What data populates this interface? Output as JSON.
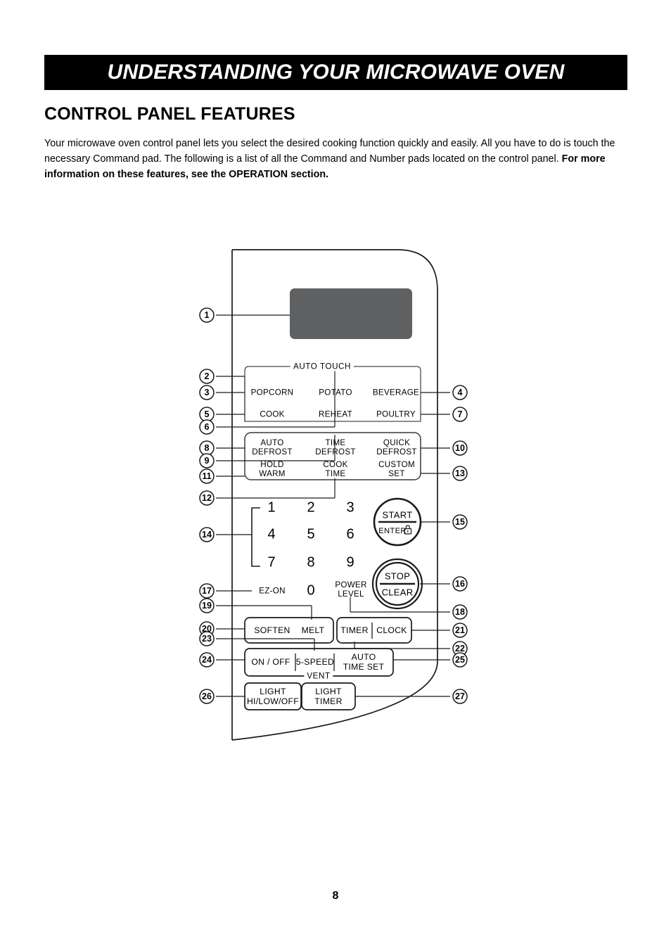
{
  "banner": {
    "title": "UNDERSTANDING YOUR MICROWAVE OVEN"
  },
  "section": {
    "heading": "CONTROL PANEL FEATURES",
    "intro_plain": "Your microwave oven control panel lets you select the desired cooking function quickly and easily. All you have to do is touch the necessary Command pad. The following is a list of all the Command and Number pads located on the control panel. ",
    "intro_bold": "For more information on these features, see the OPERATION section."
  },
  "footer": {
    "page_number": "8"
  },
  "diagram": {
    "display_color": "#5f6062",
    "group_labels": {
      "auto_touch": "AUTO TOUCH",
      "vent": "VENT"
    },
    "auto_touch_pads": [
      {
        "label": "POPCORN",
        "callout": "3"
      },
      {
        "label": "POTATO",
        "callout": "2"
      },
      {
        "label": "BEVERAGE",
        "callout": "4"
      },
      {
        "label": "COOK",
        "callout": "5"
      },
      {
        "label": "REHEAT",
        "callout": "6"
      },
      {
        "label": "POULTRY",
        "callout": "7"
      }
    ],
    "defrost_pads": [
      {
        "line1": "AUTO",
        "line2": "DEFROST",
        "callout": "8"
      },
      {
        "line1": "TIME",
        "line2": "DEFROST",
        "callout": "9"
      },
      {
        "line1": "QUICK",
        "line2": "DEFROST",
        "callout": "10"
      },
      {
        "line1": "HOLD",
        "line2": "WARM",
        "callout": "11"
      },
      {
        "line1": "COOK",
        "line2": "TIME",
        "callout": "12"
      },
      {
        "line1": "CUSTOM",
        "line2": "SET",
        "callout": "13"
      }
    ],
    "number_pads": [
      "1",
      "2",
      "3",
      "4",
      "5",
      "6",
      "7",
      "8",
      "9",
      "0"
    ],
    "number_pad_callout": "14",
    "ez_on": {
      "label": "EZ-ON",
      "callout": "17"
    },
    "power_level": {
      "line1": "POWER",
      "line2": "LEVEL",
      "callout": "18"
    },
    "start_button": {
      "line1": "START",
      "line2": "ENTER",
      "icon": "lock-icon",
      "callout": "15"
    },
    "stop_button": {
      "line1": "STOP",
      "line2": "CLEAR",
      "callout": "16"
    },
    "soften_melt": [
      {
        "label": "SOFTEN",
        "callout": "20"
      },
      {
        "label": "MELT",
        "callout": "19"
      }
    ],
    "timer_clock": [
      {
        "label": "TIMER",
        "callout": "22"
      },
      {
        "label": "CLOCK",
        "callout": "21"
      }
    ],
    "vent_controls": [
      {
        "label": "ON / OFF",
        "callout": "24"
      },
      {
        "label": "5-SPEED",
        "callout": "23"
      },
      {
        "line1": "AUTO",
        "line2": "TIME SET",
        "callout": "25"
      }
    ],
    "light_controls": [
      {
        "line1": "LIGHT",
        "line2": "HI/LOW/OFF",
        "callout": "26"
      },
      {
        "line1": "LIGHT",
        "line2": "TIMER",
        "callout": "27"
      }
    ],
    "display_callout": "1",
    "auto_touch_callout": "2",
    "callouts": [
      "1",
      "2",
      "3",
      "4",
      "5",
      "6",
      "7",
      "8",
      "9",
      "10",
      "11",
      "12",
      "13",
      "14",
      "15",
      "16",
      "17",
      "18",
      "19",
      "20",
      "21",
      "22",
      "23",
      "24",
      "25",
      "26",
      "27"
    ]
  }
}
